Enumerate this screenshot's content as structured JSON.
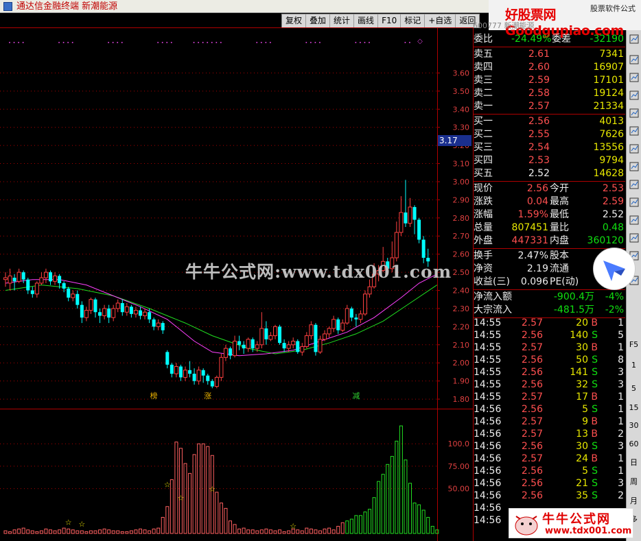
{
  "app": {
    "title": "通达信金融终端  新潮能源"
  },
  "logo": {
    "text": "好股票网Goodgupiao.com",
    "sub": "股票软件公式"
  },
  "toolbar": {
    "buttons": [
      "复权",
      "叠加",
      "统计",
      "画线",
      "F10",
      "标记",
      "+自选",
      "返回"
    ]
  },
  "header_label": "600777  新潮能源",
  "chart_data": {
    "type": "candlestick",
    "price_axis": {
      "ticks": [
        "3.60",
        "3.50",
        "3.40",
        "3.30",
        "3.20",
        "3.10",
        "3.00",
        "2.90",
        "2.80",
        "2.70",
        "2.60",
        "2.50",
        "2.40",
        "2.30",
        "2.20",
        "2.10",
        "2.00",
        "1.90",
        "1.80"
      ],
      "ylim": [
        1.77,
        3.7
      ],
      "current_price_tag": "3.17"
    },
    "volume_axis": {
      "ticks": [
        "100.0",
        "75.00",
        "50.00"
      ],
      "ylim": [
        0,
        130
      ]
    },
    "markers": [
      "榜",
      "涨",
      "减"
    ],
    "candles": [
      [
        2.46,
        2.47,
        2.5,
        2.42
      ],
      [
        2.44,
        2.48,
        2.52,
        2.4
      ],
      [
        2.47,
        2.45,
        2.49,
        2.4
      ],
      [
        2.45,
        2.5,
        2.52,
        2.44
      ],
      [
        2.5,
        2.46,
        2.51,
        2.44
      ],
      [
        2.46,
        2.4,
        2.47,
        2.38
      ],
      [
        2.4,
        2.38,
        2.42,
        2.36
      ],
      [
        2.38,
        2.44,
        2.45,
        2.36
      ],
      [
        2.44,
        2.47,
        2.5,
        2.43
      ],
      [
        2.47,
        2.5,
        2.52,
        2.44
      ],
      [
        2.5,
        2.45,
        2.51,
        2.43
      ],
      [
        2.45,
        2.48,
        2.5,
        2.43
      ],
      [
        2.48,
        2.44,
        2.49,
        2.41
      ],
      [
        2.44,
        2.41,
        2.45,
        2.39
      ],
      [
        2.41,
        2.36,
        2.42,
        2.34
      ],
      [
        2.36,
        2.38,
        2.4,
        2.34
      ],
      [
        2.38,
        2.32,
        2.4,
        2.3
      ],
      [
        2.32,
        2.25,
        2.34,
        2.22
      ],
      [
        2.25,
        2.29,
        2.31,
        2.23
      ],
      [
        2.29,
        2.35,
        2.36,
        2.27
      ],
      [
        2.35,
        2.28,
        2.36,
        2.25
      ],
      [
        2.28,
        2.26,
        2.3,
        2.22
      ],
      [
        2.26,
        2.3,
        2.32,
        2.24
      ],
      [
        2.3,
        2.25,
        2.32,
        2.22
      ],
      [
        2.25,
        2.3,
        2.32,
        2.23
      ],
      [
        2.3,
        2.33,
        2.35,
        2.28
      ],
      [
        2.33,
        2.28,
        2.35,
        2.26
      ],
      [
        2.28,
        2.31,
        2.33,
        2.26
      ],
      [
        2.31,
        2.27,
        2.32,
        2.25
      ],
      [
        2.27,
        2.29,
        2.31,
        2.25
      ],
      [
        2.29,
        2.26,
        2.31,
        2.24
      ],
      [
        2.26,
        2.28,
        2.3,
        2.24
      ],
      [
        2.28,
        2.24,
        2.3,
        2.22
      ],
      [
        2.24,
        2.2,
        2.25,
        2.18
      ],
      [
        2.2,
        2.22,
        2.24,
        2.18
      ],
      [
        2.22,
        2.18,
        2.23,
        2.16
      ],
      [
        2.06,
        1.99,
        2.07,
        1.97
      ],
      [
        1.99,
        1.94,
        2.0,
        1.92
      ],
      [
        1.94,
        1.98,
        2.0,
        1.92
      ],
      [
        1.98,
        1.92,
        1.99,
        1.9
      ],
      [
        1.92,
        1.96,
        1.98,
        1.9
      ],
      [
        1.96,
        1.94,
        2.01,
        1.92
      ],
      [
        1.94,
        1.9,
        1.97,
        1.88
      ],
      [
        1.9,
        1.96,
        1.98,
        1.88
      ],
      [
        1.96,
        1.93,
        1.97,
        1.89
      ],
      [
        1.93,
        1.9,
        1.94,
        1.88
      ],
      [
        1.9,
        1.87,
        1.91,
        1.86
      ],
      [
        1.87,
        1.92,
        1.93,
        1.86
      ],
      [
        1.92,
        2.03,
        2.05,
        1.9
      ],
      [
        2.03,
        2.08,
        2.1,
        2.01
      ],
      [
        2.08,
        2.04,
        2.09,
        2.02
      ],
      [
        2.04,
        2.12,
        2.15,
        2.03
      ],
      [
        2.12,
        2.1,
        2.15,
        2.07
      ],
      [
        2.1,
        2.08,
        2.12,
        2.05
      ],
      [
        2.08,
        2.13,
        2.14,
        2.06
      ],
      [
        2.13,
        2.08,
        2.14,
        2.06
      ],
      [
        2.08,
        2.1,
        2.12,
        2.06
      ],
      [
        2.1,
        2.19,
        2.28,
        2.08
      ],
      [
        2.19,
        2.13,
        2.23,
        2.1
      ],
      [
        2.13,
        2.15,
        2.17,
        2.12
      ],
      [
        2.15,
        2.2,
        2.21,
        2.13
      ],
      [
        2.2,
        2.11,
        2.21,
        2.1
      ],
      [
        2.11,
        2.08,
        2.13,
        2.06
      ],
      [
        2.08,
        2.1,
        2.12,
        2.06
      ],
      [
        2.1,
        2.12,
        2.14,
        2.08
      ],
      [
        2.12,
        2.06,
        2.13,
        2.05
      ],
      [
        2.06,
        2.09,
        2.11,
        2.04
      ],
      [
        2.09,
        2.15,
        2.17,
        2.08
      ],
      [
        2.15,
        2.21,
        2.23,
        2.13
      ],
      [
        2.21,
        2.06,
        2.22,
        2.04
      ],
      [
        2.06,
        2.13,
        2.15,
        2.05
      ],
      [
        2.13,
        2.16,
        2.18,
        2.12
      ],
      [
        2.16,
        2.19,
        2.2,
        2.14
      ],
      [
        2.19,
        2.24,
        2.26,
        2.17
      ],
      [
        2.24,
        2.18,
        2.25,
        2.16
      ],
      [
        2.18,
        2.22,
        2.24,
        2.17
      ],
      [
        2.22,
        2.3,
        2.32,
        2.21
      ],
      [
        2.3,
        2.25,
        2.31,
        2.23
      ],
      [
        2.25,
        2.24,
        2.27,
        2.2
      ],
      [
        2.24,
        2.27,
        2.29,
        2.22
      ],
      [
        2.27,
        2.38,
        2.4,
        2.26
      ],
      [
        2.38,
        2.42,
        2.46,
        2.36
      ],
      [
        2.42,
        2.49,
        2.55,
        2.41
      ],
      [
        2.49,
        2.51,
        2.54,
        2.45
      ],
      [
        2.51,
        2.56,
        2.64,
        2.5
      ],
      [
        2.56,
        2.52,
        2.58,
        2.49
      ],
      [
        2.52,
        2.58,
        2.67,
        2.5
      ],
      [
        2.58,
        2.72,
        2.78,
        2.56
      ],
      [
        2.72,
        2.83,
        2.92,
        2.7
      ],
      [
        2.83,
        2.77,
        3.01,
        2.75
      ],
      [
        2.77,
        2.86,
        2.91,
        2.75
      ],
      [
        2.86,
        2.79,
        2.87,
        2.71
      ],
      [
        2.79,
        2.68,
        2.8,
        2.66
      ],
      [
        2.68,
        2.58,
        2.7,
        2.55
      ],
      [
        2.58,
        2.56,
        2.63,
        2.53
      ]
    ],
    "volumes": [
      3,
      2,
      4,
      5,
      6,
      4,
      3,
      2,
      3,
      5,
      4,
      3,
      4,
      6,
      5,
      4,
      3,
      3,
      2,
      3,
      3,
      4,
      5,
      4,
      3,
      3,
      2,
      2,
      3,
      4,
      5,
      4,
      3,
      5,
      6,
      18,
      30,
      60,
      102,
      95,
      78,
      67,
      88,
      100,
      100,
      97,
      87,
      46,
      34,
      28,
      14,
      10,
      5,
      6,
      4,
      4,
      3,
      4,
      5,
      4,
      3,
      4,
      2,
      3,
      5,
      4,
      3,
      6,
      5,
      4,
      3,
      5,
      6,
      4,
      8,
      12,
      14,
      16,
      20,
      20,
      24,
      27,
      40,
      58,
      66,
      77,
      86,
      103,
      120,
      82,
      56,
      34,
      32,
      26,
      18,
      8,
      4
    ],
    "ma_short": [
      [
        0,
        2.44
      ],
      [
        6,
        2.46
      ],
      [
        12,
        2.46
      ],
      [
        18,
        2.43
      ],
      [
        24,
        2.37
      ],
      [
        30,
        2.31
      ],
      [
        36,
        2.24
      ],
      [
        42,
        2.12
      ],
      [
        46,
        2.06
      ],
      [
        52,
        2.04
      ],
      [
        58,
        2.05
      ],
      [
        64,
        2.07
      ],
      [
        70,
        2.12
      ],
      [
        76,
        2.17
      ],
      [
        82,
        2.25
      ],
      [
        88,
        2.36
      ],
      [
        92,
        2.44
      ],
      [
        96,
        2.49
      ]
    ],
    "ma_long": [
      [
        0,
        2.4
      ],
      [
        8,
        2.43
      ],
      [
        16,
        2.41
      ],
      [
        24,
        2.37
      ],
      [
        32,
        2.3
      ],
      [
        40,
        2.22
      ],
      [
        46,
        2.15
      ],
      [
        54,
        2.08
      ],
      [
        60,
        2.05
      ],
      [
        66,
        2.07
      ],
      [
        72,
        2.11
      ],
      [
        78,
        2.16
      ],
      [
        84,
        2.23
      ],
      [
        90,
        2.33
      ],
      [
        96,
        2.43
      ]
    ]
  },
  "order_book": {
    "weibi": {
      "label": "委比",
      "value": "-24.49%",
      "label2": "委差",
      "value2": "-32190"
    },
    "asks": [
      {
        "label": "卖五",
        "price": "2.61",
        "vol": "7341"
      },
      {
        "label": "卖四",
        "price": "2.60",
        "vol": "16907"
      },
      {
        "label": "卖三",
        "price": "2.59",
        "vol": "17101"
      },
      {
        "label": "卖二",
        "price": "2.58",
        "vol": "19124"
      },
      {
        "label": "卖一",
        "price": "2.57",
        "vol": "21334"
      }
    ],
    "bids": [
      {
        "label": "买一",
        "price": "2.56",
        "vol": "4013",
        "color": "red"
      },
      {
        "label": "买二",
        "price": "2.55",
        "vol": "7626",
        "color": "red"
      },
      {
        "label": "买三",
        "price": "2.54",
        "vol": "13556",
        "color": "red"
      },
      {
        "label": "买四",
        "price": "2.53",
        "vol": "9794",
        "color": "red"
      },
      {
        "label": "买五",
        "price": "2.52",
        "vol": "14628",
        "color": "wht"
      }
    ]
  },
  "stats": [
    {
      "l1": "现价",
      "v1": "2.56",
      "c1": "red",
      "l2": "今开",
      "v2": "2.53",
      "c2": "red"
    },
    {
      "l1": "涨跌",
      "v1": "0.04",
      "c1": "red",
      "l2": "最高",
      "v2": "2.59",
      "c2": "red"
    },
    {
      "l1": "涨幅",
      "v1": "1.59%",
      "c1": "red",
      "l2": "最低",
      "v2": "2.52",
      "c2": "wht"
    },
    {
      "l1": "总量",
      "v1": "807451",
      "c1": "yel",
      "l2": "量比",
      "v2": "0.48",
      "c2": "grn"
    },
    {
      "l1": "外盘",
      "v1": "447331",
      "c1": "red",
      "l2": "内盘",
      "v2": "360120",
      "c2": "grn"
    }
  ],
  "finance": [
    {
      "l1": "换手",
      "v1": "2.47%",
      "l2": "股本",
      "v2": ""
    },
    {
      "l1": "净资",
      "v1": "2.19",
      "l2": "流通",
      "v2": ""
    },
    {
      "l1": "收益(三)",
      "v1": "0.096",
      "l2": "PE(动)",
      "v2": ""
    }
  ],
  "flows": [
    {
      "label": "净流入额",
      "value": "-900.4万",
      "pct": "-4%"
    },
    {
      "label": "大宗流入",
      "value": "-481.5万",
      "pct": "-2%"
    }
  ],
  "ticks": [
    {
      "time": "14:55",
      "price": "2.57",
      "vol": "20",
      "side": "B",
      "n": "1"
    },
    {
      "time": "14:55",
      "price": "2.56",
      "vol": "140",
      "side": "S",
      "n": "5"
    },
    {
      "time": "14:55",
      "price": "2.57",
      "vol": "30",
      "side": "B",
      "n": "1"
    },
    {
      "time": "14:55",
      "price": "2.56",
      "vol": "50",
      "side": "S",
      "n": "8"
    },
    {
      "time": "14:55",
      "price": "2.56",
      "vol": "141",
      "side": "S",
      "n": "3"
    },
    {
      "time": "14:55",
      "price": "2.56",
      "vol": "32",
      "side": "S",
      "n": "3"
    },
    {
      "time": "14:55",
      "price": "2.57",
      "vol": "17",
      "side": "B",
      "n": "1"
    },
    {
      "time": "14:56",
      "price": "2.56",
      "vol": "5",
      "side": "S",
      "n": "1"
    },
    {
      "time": "14:56",
      "price": "2.57",
      "vol": "9",
      "side": "B",
      "n": "1"
    },
    {
      "time": "14:56",
      "price": "2.57",
      "vol": "13",
      "side": "B",
      "n": "2"
    },
    {
      "time": "14:56",
      "price": "2.56",
      "vol": "30",
      "side": "S",
      "n": "3"
    },
    {
      "time": "14:56",
      "price": "2.57",
      "vol": "24",
      "side": "B",
      "n": "1"
    },
    {
      "time": "14:56",
      "price": "2.56",
      "vol": "5",
      "side": "S",
      "n": "1"
    },
    {
      "time": "14:56",
      "price": "2.56",
      "vol": "21",
      "side": "S",
      "n": "3"
    },
    {
      "time": "14:56",
      "price": "2.56",
      "vol": "35",
      "side": "S",
      "n": "2"
    },
    {
      "time": "14:56",
      "price": "",
      "vol": "",
      "side": "",
      "n": ""
    },
    {
      "time": "14:56",
      "price": "",
      "vol": "",
      "side": "",
      "n": ""
    }
  ],
  "sidebar": {
    "items": [
      "F5",
      "1",
      "5",
      "15",
      "30",
      "60",
      "日",
      "周",
      "月",
      "多"
    ]
  },
  "watermark": "牛牛公式网:www.tdx001.com",
  "bottom_ad": {
    "title": "牛牛公式网",
    "url": "www.tdx001.com"
  },
  "colors": {
    "up": "#ff4040",
    "down": "#00ffff",
    "vol_up": "#ff6060",
    "vol_down": "#22e022",
    "ma_short": "#ff40ff",
    "ma_long": "#20e020",
    "grid": "#b00000"
  }
}
